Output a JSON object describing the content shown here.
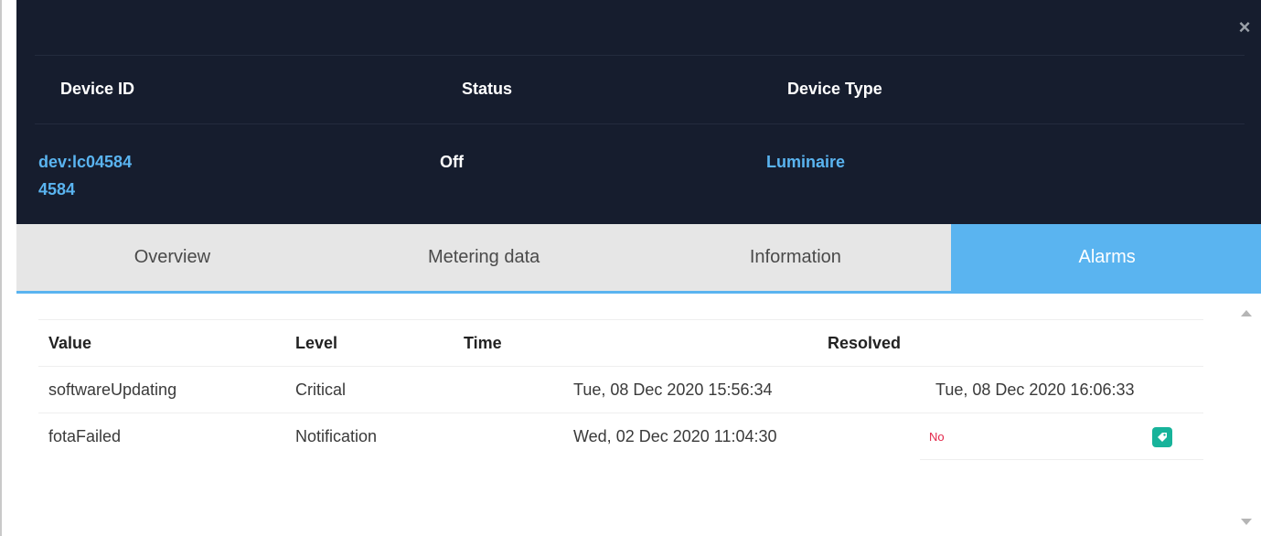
{
  "header": {
    "columns": {
      "device_id": "Device ID",
      "status": "Status",
      "device_type": "Device Type"
    },
    "values": {
      "device_id_line1": "dev:lc04584",
      "device_id_line2": "4584",
      "status": "Off",
      "device_type": "Luminaire"
    }
  },
  "close_icon": "×",
  "tabs": [
    {
      "label": "Overview",
      "active": false
    },
    {
      "label": "Metering data",
      "active": false
    },
    {
      "label": "Information",
      "active": false
    },
    {
      "label": "Alarms",
      "active": true
    }
  ],
  "alarms": {
    "columns": {
      "value": "Value",
      "level": "Level",
      "time": "Time",
      "resolved": "Resolved"
    },
    "rows": [
      {
        "value": "softwareUpdating",
        "level": "Critical",
        "time": "Tue, 08 Dec 2020 15:56:34",
        "resolved": "Tue, 08 Dec 2020 16:06:33"
      },
      {
        "value": "fotaFailed",
        "level": "Notification",
        "time": "Wed, 02 Dec 2020 11:04:30",
        "resolved": "No"
      }
    ]
  },
  "icons": {
    "close": "close-icon",
    "edit": "edit-tag-icon",
    "scroll_up": "scroll-up-arrow-icon",
    "scroll_down": "scroll-down-arrow-icon"
  },
  "colors": {
    "header_bg": "#161d2e",
    "accent": "#5ab4f0",
    "unresolved": "#e3274a",
    "action": "#17b39a"
  }
}
